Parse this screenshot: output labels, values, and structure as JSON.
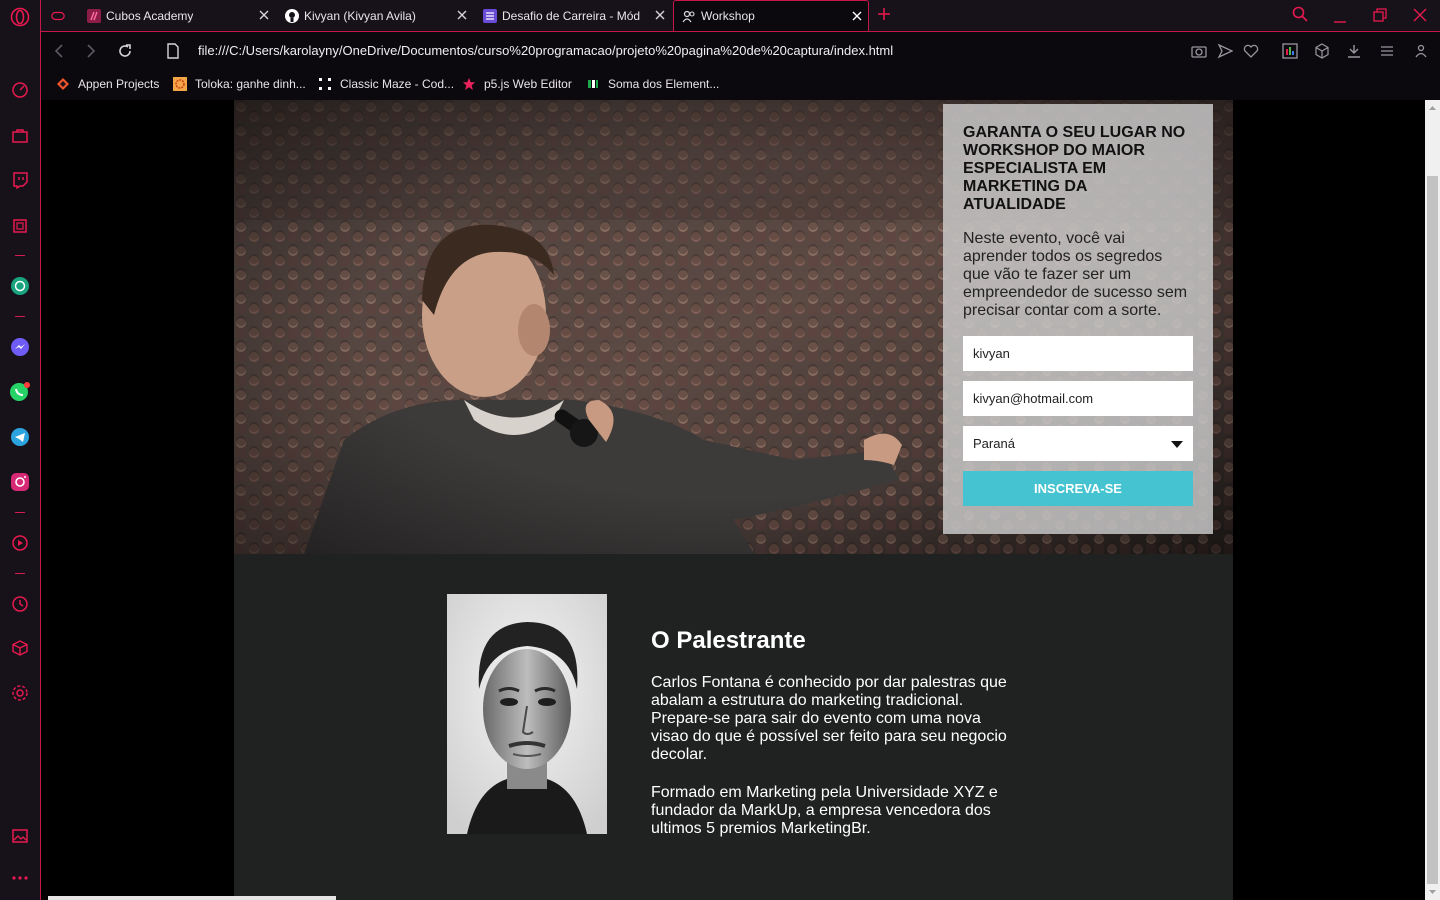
{
  "browser": {
    "tabs": [
      {
        "label": "",
        "icon": "gamepad-icon"
      },
      {
        "label": "Cubos Academy",
        "icon": "cubos-icon"
      },
      {
        "label": "Kivyan (Kivyan Avila)",
        "icon": "github-icon"
      },
      {
        "label": "Desafio de Carreira - Módu",
        "icon": "list-icon"
      },
      {
        "label": "Workshop",
        "icon": "people-icon"
      }
    ],
    "url": "file:///C:/Users/karolayny/OneDrive/Documentos/curso%20programacao/projeto%20pagina%20de%20captura/index.html",
    "bookmarks": [
      {
        "label": "Appen Projects",
        "icon": "appen-icon"
      },
      {
        "label": "Toloka: ganhe dinh...",
        "icon": "toloka-icon"
      },
      {
        "label": "Classic Maze - Cod...",
        "icon": "maze-icon"
      },
      {
        "label": "p5.js Web Editor",
        "icon": "star-icon"
      },
      {
        "label": "Soma dos Element...",
        "icon": "hackerrank-icon"
      }
    ],
    "accent": "#c4174a"
  },
  "hero": {
    "title": "GARANTA O SEU LUGAR NO WORKSHOP DO MAIOR ESPECIALISTA EM MARKETING DA ATUALIDADE",
    "description": "Neste evento, você vai aprender todos os segredos que vão te fazer ser um empreendedor de sucesso sem precisar contar com a sorte.",
    "form": {
      "name_value": "kivyan",
      "email_value": "kivyan@hotmail.com",
      "state_value": "Paraná",
      "submit_label": "INSCREVA-SE",
      "button_color": "#45c3d0"
    }
  },
  "speaker": {
    "heading": "O Palestrante",
    "paragraph1": "Carlos Fontana é conhecido por dar palestras que abalam a estrutura do marketing tradicional. Prepare-se para sair do evento com uma nova visao do que é possível ser feito para seu negocio decolar.",
    "paragraph2": "Formado em Marketing pela Universidade XYZ e fundador da MarkUp, a empresa vencedora dos ultimos 5 premios MarketingBr."
  }
}
